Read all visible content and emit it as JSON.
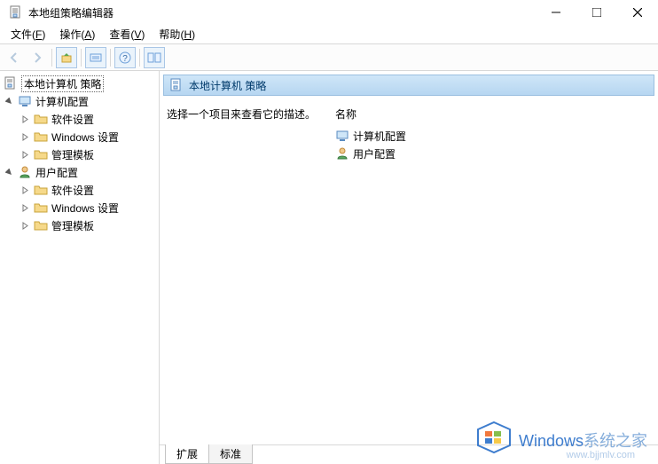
{
  "window": {
    "title": "本地组策略编辑器"
  },
  "menus": [
    {
      "label": "文件",
      "hotkey": "F"
    },
    {
      "label": "操作",
      "hotkey": "A"
    },
    {
      "label": "查看",
      "hotkey": "V"
    },
    {
      "label": "帮助",
      "hotkey": "H"
    }
  ],
  "tree": {
    "root": "本地计算机 策略",
    "sections": [
      {
        "label": "计算机配置",
        "children": [
          {
            "label": "软件设置"
          },
          {
            "label": "Windows 设置"
          },
          {
            "label": "管理模板"
          }
        ]
      },
      {
        "label": "用户配置",
        "children": [
          {
            "label": "软件设置"
          },
          {
            "label": "Windows 设置"
          },
          {
            "label": "管理模板"
          }
        ]
      }
    ]
  },
  "detail": {
    "header": "本地计算机 策略",
    "prompt": "选择一个项目来查看它的描述。",
    "columnHeader": "名称",
    "items": [
      {
        "label": "计算机配置"
      },
      {
        "label": "用户配置"
      }
    ]
  },
  "tabs": [
    "扩展",
    "标准"
  ],
  "watermark": {
    "brand1a": "Windows",
    "brand1b": "系统之家",
    "url": "www.bjjmlv.com"
  }
}
